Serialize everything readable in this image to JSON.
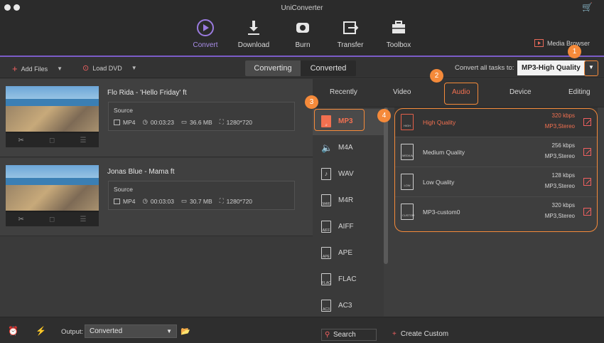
{
  "app": {
    "title": "UniConverter"
  },
  "nav": [
    {
      "label": "Convert",
      "icon": "convert-icon"
    },
    {
      "label": "Download",
      "icon": "download-icon"
    },
    {
      "label": "Burn",
      "icon": "burn-icon"
    },
    {
      "label": "Transfer",
      "icon": "transfer-icon"
    },
    {
      "label": "Toolbox",
      "icon": "toolbox-icon"
    }
  ],
  "media_browser": "Media Browser",
  "toolbar": {
    "add_files": "Add Files",
    "load_dvd": "Load DVD",
    "tab_converting": "Converting",
    "tab_converted": "Converted",
    "convert_all_label": "Convert all tasks to:",
    "preset": "MP3-High Quality"
  },
  "files": [
    {
      "title": "Flo Rida - 'Hello Friday' ft",
      "source_label": "Source",
      "format": "MP4",
      "duration": "00:03:23",
      "size": "36.6 MB",
      "resolution": "1280*720"
    },
    {
      "title": "Jonas Blue - Mama ft",
      "source_label": "Source",
      "format": "MP4",
      "duration": "00:03:03",
      "size": "30.7 MB",
      "resolution": "1280*720"
    }
  ],
  "panel": {
    "tabs": [
      "Recently",
      "Video",
      "Audio",
      "Device",
      "Editing"
    ],
    "active_tab": "Audio",
    "formats": [
      "MP3",
      "M4A",
      "WAV",
      "M4R",
      "AIFF",
      "APE",
      "FLAC",
      "AC3"
    ],
    "active_format": "MP3",
    "qualities": [
      {
        "name": "High Quality",
        "bitrate": "320 kbps",
        "channels": "MP3,Stereo",
        "tag": "HIGH"
      },
      {
        "name": "Medium Quality",
        "bitrate": "256 kbps",
        "channels": "MP3,Stereo",
        "tag": "MEDIUM"
      },
      {
        "name": "Low Quality",
        "bitrate": "128 kbps",
        "channels": "MP3,Stereo",
        "tag": "LOW"
      },
      {
        "name": "MP3-custom0",
        "bitrate": "320 kbps",
        "channels": "MP3,Stereo",
        "tag": "CUSTOM"
      }
    ]
  },
  "bottom": {
    "output_label": "Output:",
    "output_value": "Converted",
    "search": "Search",
    "create_custom": "Create Custom"
  },
  "badges": [
    "1",
    "2",
    "3",
    "4"
  ],
  "colors": {
    "accent_purple": "#7b5cc8",
    "highlight_orange": "#f58a3a",
    "active_red": "#f27050"
  }
}
